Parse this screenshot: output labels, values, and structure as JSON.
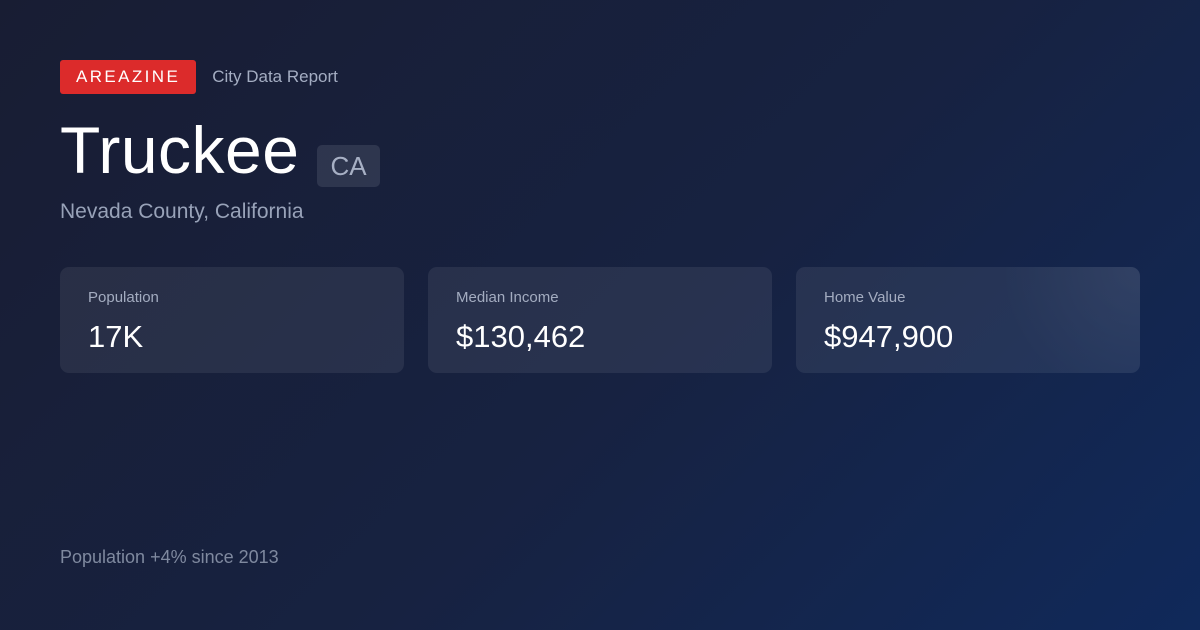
{
  "header": {
    "brand": "AREAZINE",
    "report_label": "City Data Report"
  },
  "city": {
    "name": "Truckee",
    "state": "CA",
    "county_line": "Nevada County, California"
  },
  "stats": [
    {
      "label": "Population",
      "value": "17K"
    },
    {
      "label": "Median Income",
      "value": "$130,462"
    },
    {
      "label": "Home Value",
      "value": "$947,900"
    }
  ],
  "footer": {
    "note": "Population +4% since 2013"
  },
  "colors": {
    "brand": "#dc2b2b",
    "background_start": "#181d33",
    "background_end": "#10295a"
  }
}
